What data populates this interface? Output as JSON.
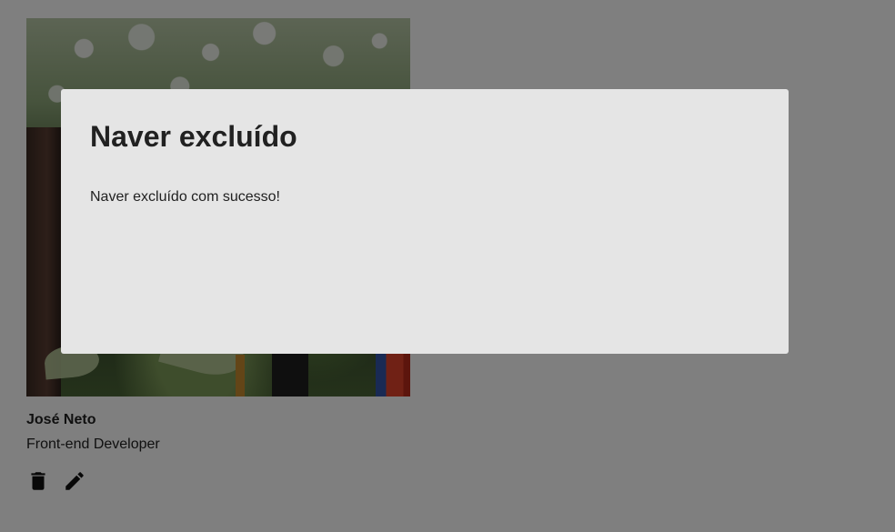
{
  "card": {
    "photo_alt": "José Neto",
    "name": "José Neto",
    "role": "Front-end Developer",
    "actions": {
      "delete_icon": "trash-icon",
      "edit_icon": "pencil-icon"
    }
  },
  "modal": {
    "title": "Naver excluído",
    "message": "Naver excluído com sucesso!"
  },
  "colors": {
    "text": "#212121",
    "modal_bg": "#e5e5e5",
    "overlay": "rgba(0,0,0,0.5)"
  }
}
